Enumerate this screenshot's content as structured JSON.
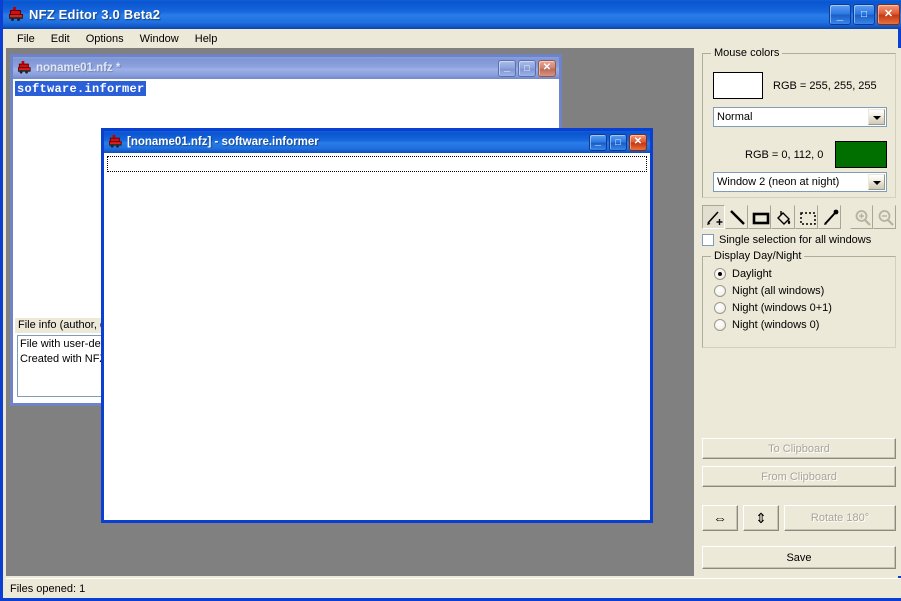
{
  "app": {
    "title": "NFZ Editor 3.0 Beta2",
    "icon": "train-icon",
    "caption_buttons": [
      {
        "name": "minimize-button",
        "glyph": "_"
      },
      {
        "name": "maximize-button",
        "glyph": "□"
      },
      {
        "name": "close-button",
        "glyph": "✕"
      }
    ]
  },
  "menu": {
    "items": [
      {
        "label": "File"
      },
      {
        "label": "Edit"
      },
      {
        "label": "Options"
      },
      {
        "label": "Window"
      },
      {
        "label": "Help"
      }
    ]
  },
  "windows": {
    "child1": {
      "title": "noname01.nfz *",
      "icon": "train-icon",
      "name_field_value": "software.informer",
      "info_label": "File info (author, d",
      "info_lines": [
        "File with user-defin",
        "Created with NFZ"
      ],
      "caption_buttons": [
        {
          "name": "minimize-button",
          "glyph": "_"
        },
        {
          "name": "maximize-button",
          "glyph": "□"
        },
        {
          "name": "close-button",
          "glyph": "✕"
        }
      ]
    },
    "child2": {
      "title": "[noname01.nfz] - software.informer",
      "icon": "train-icon",
      "field_value": "",
      "caption_buttons": [
        {
          "name": "minimize-button",
          "glyph": "_"
        },
        {
          "name": "maximize-button",
          "glyph": "□"
        },
        {
          "name": "close-button",
          "glyph": "✕"
        }
      ]
    }
  },
  "panel": {
    "mouse_colors": {
      "title": "Mouse colors",
      "primary_swatch_color": "#ffffff",
      "primary_rgb_label": "RGB = 255, 255, 255",
      "mode_combo_value": "Normal",
      "secondary_rgb_label": "RGB = 0, 112, 0",
      "secondary_swatch_color": "#006f00",
      "window_combo_value": "Window 2 (neon at night)"
    },
    "tools": [
      {
        "name": "pencil-add-tool",
        "icon": "pencil-plus-icon",
        "selected": true,
        "enabled": true
      },
      {
        "name": "line-tool",
        "icon": "line-icon",
        "selected": false,
        "enabled": true
      },
      {
        "name": "rectangle-tool",
        "icon": "rectangle-icon",
        "selected": false,
        "enabled": true
      },
      {
        "name": "fill-tool",
        "icon": "paint-bucket-icon",
        "selected": false,
        "enabled": true
      },
      {
        "name": "select-tool",
        "icon": "marquee-icon",
        "selected": false,
        "enabled": true
      },
      {
        "name": "eyedropper-tool",
        "icon": "eyedropper-icon",
        "selected": false,
        "enabled": true
      },
      {
        "name": "zoom-in-tool",
        "icon": "magnifier-plus-icon",
        "selected": false,
        "enabled": false
      },
      {
        "name": "zoom-out-tool",
        "icon": "magnifier-minus-icon",
        "selected": false,
        "enabled": false
      }
    ],
    "single_selection": {
      "label": "Single selection for all windows",
      "checked": false
    },
    "day_night": {
      "title": "Display Day/Night",
      "options": [
        {
          "label": "Daylight",
          "checked": true
        },
        {
          "label": "Night (all windows)",
          "checked": false
        },
        {
          "label": "Night (windows 0+1)",
          "checked": false
        },
        {
          "label": "Night (windows 0)",
          "checked": false
        }
      ]
    },
    "buttons": {
      "to_clipboard": "To Clipboard",
      "from_clipboard": "From Clipboard",
      "flip_horizontal": "⇔",
      "flip_vertical": "⇕",
      "rotate": "Rotate 180°",
      "save": "Save"
    }
  },
  "status": {
    "text": "Files opened: 1"
  },
  "colors": {
    "title_blue": "#0a55d0",
    "face": "#ece9d8",
    "mdi_background": "#808080",
    "border_blue": "#0a3fd1",
    "secondary_color": "#006f00"
  }
}
